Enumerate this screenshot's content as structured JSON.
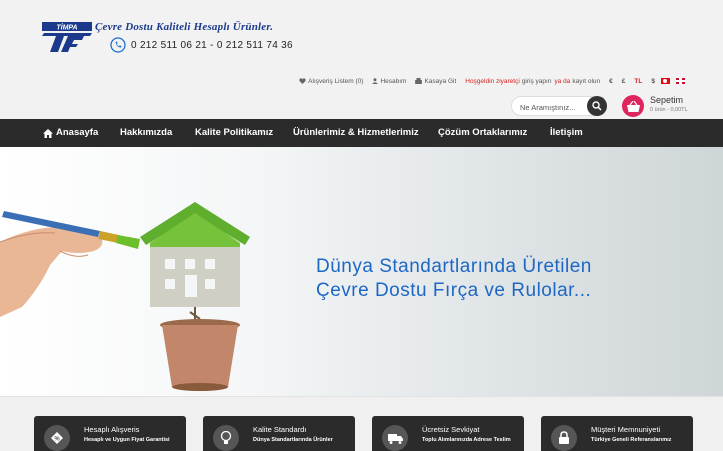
{
  "header": {
    "logo_text": "TİMPA",
    "slogan": "Çevre Dostu Kaliteli Hesaplı Ürünler.",
    "phone": "0 212 511 06 21 - 0 212 511 74 36"
  },
  "topbar": {
    "wishlist": "Alışveriş Listem (0)",
    "account": "Hesabım",
    "checkout": "Kasaya Git",
    "welcome": "Hoşgeldin ziyaretçi",
    "login": "giriş yapın",
    "or": "ya da",
    "register": "kayıt olun",
    "currencies": [
      "€",
      "£",
      "TL",
      "$"
    ]
  },
  "search": {
    "placeholder": "Ne Aramıştınız..."
  },
  "cart": {
    "title": "Sepetim",
    "summary": "0 ürün - 0,00TL"
  },
  "nav": {
    "items": [
      {
        "label": "Anasayfa"
      },
      {
        "label": "Hakkımızda"
      },
      {
        "label": "Kalite Politikamız"
      },
      {
        "label": "Ürünlerimiz & Hizmetlerimiz"
      },
      {
        "label": "Çözüm Ortaklarımız"
      },
      {
        "label": "İletişim"
      }
    ]
  },
  "hero": {
    "line1": "Dünya Standartlarında Üretilen",
    "line2": "Çevre Dostu Fırça ve Rulolar..."
  },
  "features": [
    {
      "title": "Hesaplı Alışveris",
      "subtitle": "Hesaplı ve Uygun Fiyat Garantisi",
      "icon": "discount-tag-icon"
    },
    {
      "title": "Kalite Standardı",
      "subtitle": "Dünya Standartlarında Ürünler",
      "icon": "lightbulb-icon"
    },
    {
      "title": "Ücretsiz Sevkiyat",
      "subtitle": "Toplu Alımlarınızda Adrese Teslim",
      "icon": "truck-icon"
    },
    {
      "title": "Müşteri Memnuniyeti",
      "subtitle": "Türkiye Geneli Referanslarımız",
      "icon": "lock-icon"
    }
  ],
  "colors": {
    "accent": "#e0245e",
    "nav_bg": "#2b2b2b",
    "hero_text": "#1d67c5",
    "brand_blue": "#1c3a8c",
    "alert_red": "#d42222"
  }
}
